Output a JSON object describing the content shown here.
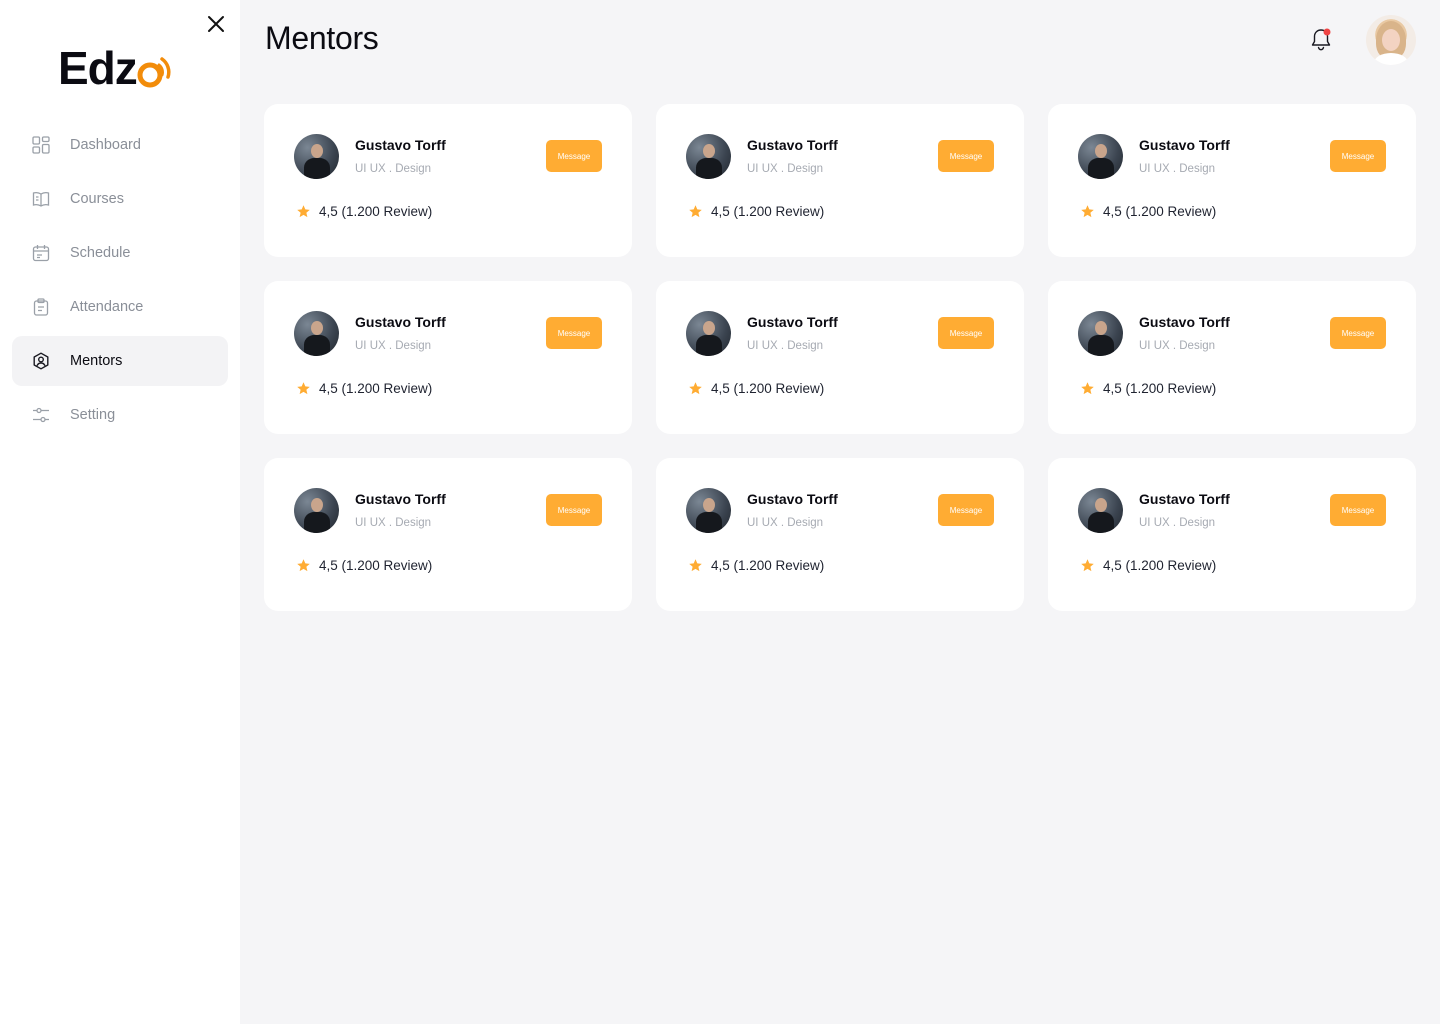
{
  "app": {
    "logo_text": "Edz",
    "page_title": "Mentors"
  },
  "colors": {
    "accent": "#ffac33",
    "logo_accent": "#f28c0a",
    "active_nav_bg": "#f3f3f5",
    "notification_dot": "#ef4444"
  },
  "sidebar": {
    "items": [
      {
        "label": "Dashboard",
        "icon": "grid-icon",
        "active": false
      },
      {
        "label": "Courses",
        "icon": "book-icon",
        "active": false
      },
      {
        "label": "Schedule",
        "icon": "calendar-icon",
        "active": false
      },
      {
        "label": "Attendance",
        "icon": "clipboard-icon",
        "active": false
      },
      {
        "label": "Mentors",
        "icon": "user-badge-icon",
        "active": true
      },
      {
        "label": "Setting",
        "icon": "sliders-icon",
        "active": false
      }
    ]
  },
  "mentors": [
    {
      "name": "Gustavo Torff",
      "role": "UI UX . Design",
      "rating": "4,5 (1.200 Review)",
      "button": "Message"
    },
    {
      "name": "Gustavo Torff",
      "role": "UI UX . Design",
      "rating": "4,5 (1.200 Review)",
      "button": "Message"
    },
    {
      "name": "Gustavo Torff",
      "role": "UI UX . Design",
      "rating": "4,5 (1.200 Review)",
      "button": "Message"
    },
    {
      "name": "Gustavo Torff",
      "role": "UI UX . Design",
      "rating": "4,5 (1.200 Review)",
      "button": "Message"
    },
    {
      "name": "Gustavo Torff",
      "role": "UI UX . Design",
      "rating": "4,5 (1.200 Review)",
      "button": "Message"
    },
    {
      "name": "Gustavo Torff",
      "role": "UI UX . Design",
      "rating": "4,5 (1.200 Review)",
      "button": "Message"
    },
    {
      "name": "Gustavo Torff",
      "role": "UI UX . Design",
      "rating": "4,5 (1.200 Review)",
      "button": "Message"
    },
    {
      "name": "Gustavo Torff",
      "role": "UI UX . Design",
      "rating": "4,5 (1.200 Review)",
      "button": "Message"
    },
    {
      "name": "Gustavo Torff",
      "role": "UI UX . Design",
      "rating": "4,5 (1.200 Review)",
      "button": "Message"
    }
  ]
}
